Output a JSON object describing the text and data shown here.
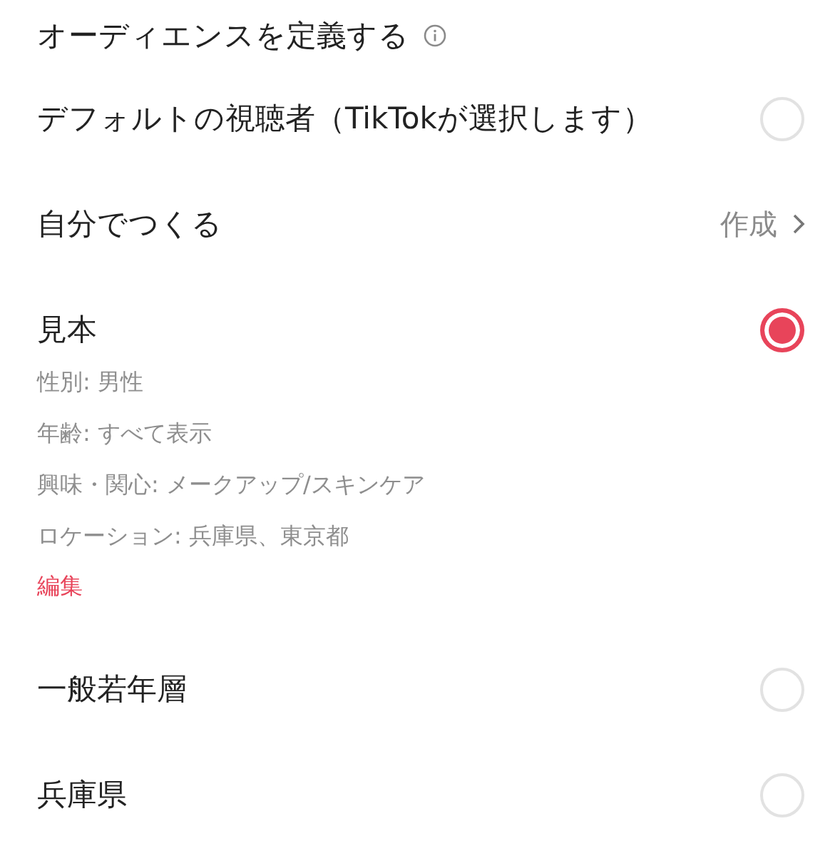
{
  "header": {
    "title": "オーディエンスを定義する"
  },
  "options": [
    {
      "kind": "radio",
      "label": "デフォルトの視聴者（TikTokが選択します）",
      "selected": false
    },
    {
      "kind": "link",
      "label": "自分でつくる",
      "action": "作成"
    },
    {
      "kind": "radio",
      "label": "見本",
      "selected": true,
      "details": [
        "性別: 男性",
        "年齢: すべて表示",
        "興味・関心: メークアップ/スキンケア",
        "ロケーション: 兵庫県、東京都"
      ],
      "edit": "編集"
    },
    {
      "kind": "radio",
      "label": "一般若年層",
      "selected": false
    },
    {
      "kind": "radio",
      "label": "兵庫県",
      "selected": false
    }
  ]
}
